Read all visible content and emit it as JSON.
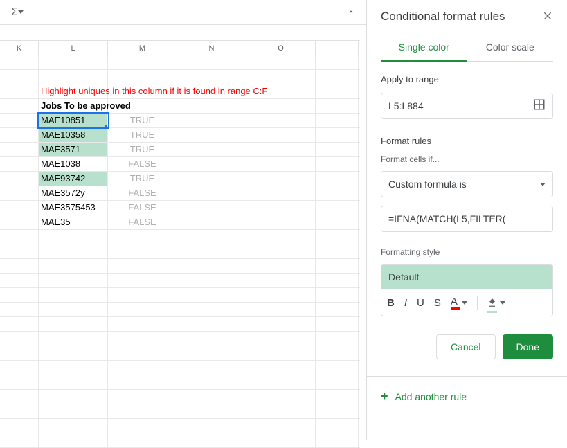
{
  "toolbar": {
    "sigma": "Σ"
  },
  "columns": [
    "K",
    "L",
    "M",
    "N",
    "O",
    ""
  ],
  "rows": [
    {
      "L": "",
      "M": ""
    },
    {
      "L": "",
      "M": ""
    },
    {
      "red": "Highlight uniques in this column if it is found in range C:F"
    },
    {
      "L_bold": "Jobs To be approved"
    },
    {
      "L": "MAE10851",
      "M": "TRUE",
      "hl": true,
      "sel": true
    },
    {
      "L": "MAE10358",
      "M": "TRUE",
      "hl": true
    },
    {
      "L": "MAE3571",
      "M": "TRUE",
      "hl": true
    },
    {
      "L": "MAE1038",
      "M": "FALSE"
    },
    {
      "L": "MAE93742",
      "M": "TRUE",
      "hl": true
    },
    {
      "L": "MAE3572y",
      "M": "FALSE"
    },
    {
      "L": "MAE3575453",
      "M": "FALSE"
    },
    {
      "L": "MAE35",
      "M": "FALSE"
    },
    {
      "L": "",
      "M": ""
    },
    {
      "L": "",
      "M": ""
    },
    {
      "L": "",
      "M": ""
    },
    {
      "L": "",
      "M": ""
    },
    {
      "L": "",
      "M": ""
    },
    {
      "L": "",
      "M": ""
    },
    {
      "L": "",
      "M": ""
    },
    {
      "L": "",
      "M": ""
    },
    {
      "L": "",
      "M": ""
    },
    {
      "L": "",
      "M": ""
    },
    {
      "L": "",
      "M": ""
    },
    {
      "L": "",
      "M": ""
    },
    {
      "L": "",
      "M": ""
    },
    {
      "L": "",
      "M": ""
    },
    {
      "L": "",
      "M": ""
    }
  ],
  "panel": {
    "title": "Conditional format rules",
    "tabs": {
      "single": "Single color",
      "scale": "Color scale"
    },
    "apply_label": "Apply to range",
    "range_value": "L5:L884",
    "rules_label": "Format rules",
    "cells_if_label": "Format cells if...",
    "condition": "Custom formula is",
    "formula": "=IFNA(MATCH(L5,FILTER(",
    "style_label": "Formatting style",
    "style_name": "Default",
    "bold": "B",
    "italic": "I",
    "underline": "U",
    "strike": "S",
    "textcolor": "A",
    "cancel": "Cancel",
    "done": "Done",
    "add_rule": "Add another rule"
  }
}
